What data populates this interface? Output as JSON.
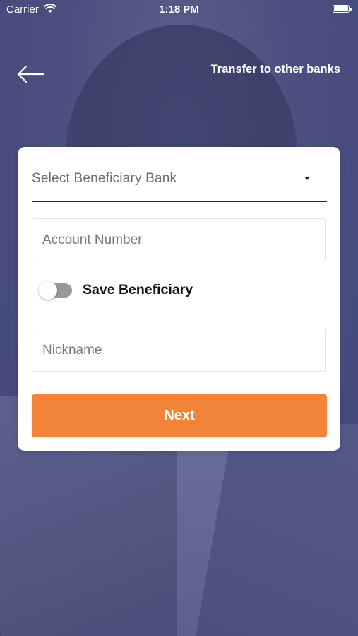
{
  "status_bar": {
    "carrier": "Carrier",
    "time": "1:18 PM",
    "wifi_icon": "wifi-icon",
    "battery_icon": "battery-icon"
  },
  "header": {
    "back_icon": "arrow-left-icon",
    "title": "Transfer to other banks"
  },
  "form": {
    "bank_select": {
      "placeholder": "Select Beneficiary Bank",
      "icon": "caret-down-icon"
    },
    "account_number": {
      "placeholder": "Account Number",
      "value": ""
    },
    "save_beneficiary": {
      "label": "Save Beneficiary",
      "enabled": false
    },
    "nickname": {
      "placeholder": "Nickname",
      "value": ""
    },
    "next_label": "Next"
  },
  "colors": {
    "accent": "#f2843a",
    "background_overlay": "#4a4f7a",
    "card": "#ffffff",
    "toggle_off": "#999999"
  }
}
